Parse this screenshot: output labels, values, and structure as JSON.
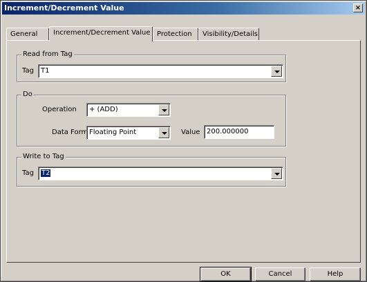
{
  "window": {
    "title": "Increment/Decrement Value",
    "close_label": "×"
  },
  "tabs": [
    {
      "label": "General"
    },
    {
      "label": "Increment/Decrement Value"
    },
    {
      "label": "Protection"
    },
    {
      "label": "Visibility/Details"
    }
  ],
  "read_group": {
    "title": "Read from Tag",
    "tag_label": "Tag",
    "tag_value": "T1"
  },
  "do_group": {
    "title": "Do",
    "operation_label": "Operation",
    "operation_value": "+ (ADD)",
    "format_label": "Data Format",
    "format_value": "Floating Point",
    "value_label": "Value",
    "value_value": "200.000000"
  },
  "write_group": {
    "title": "Write to Tag",
    "tag_label": "Tag",
    "tag_value": "T2"
  },
  "buttons": {
    "ok": "OK",
    "cancel": "Cancel",
    "help": "Help"
  }
}
